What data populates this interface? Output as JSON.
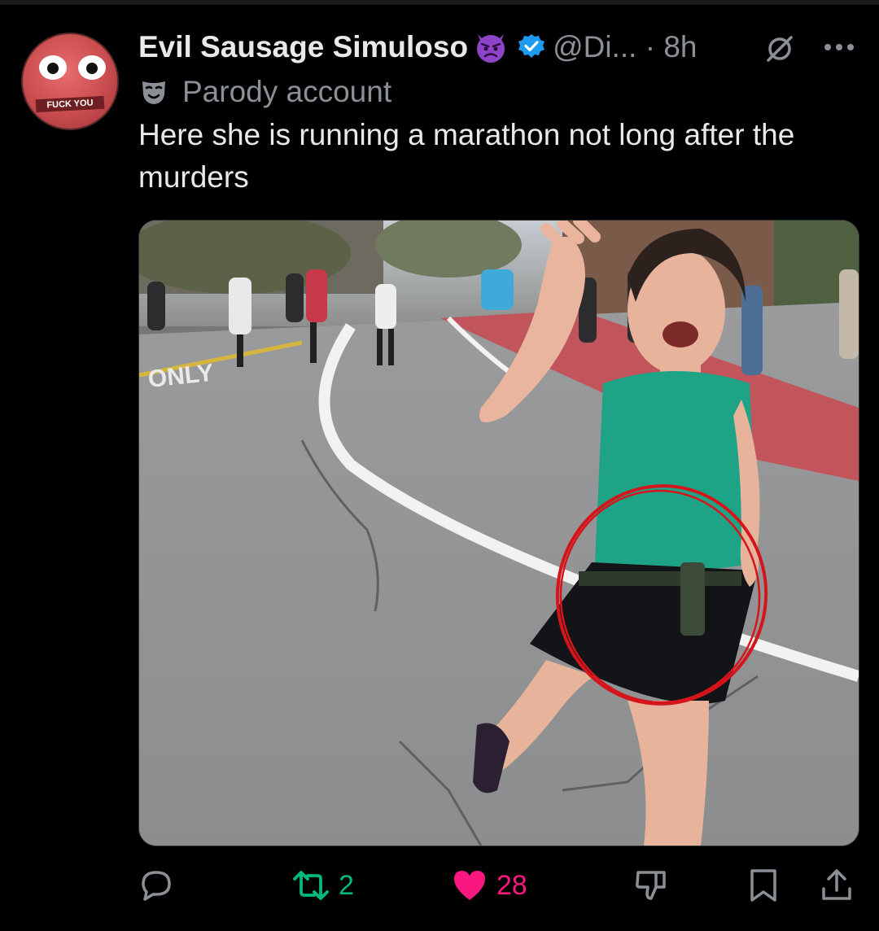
{
  "tweet": {
    "author_name": "Evil Sausage Simuloso",
    "meta": "@Di... · 8h",
    "label": "Parody account",
    "text": "Here she is running a marathon not long after the murders",
    "avatar_text": "FUCK YOU",
    "photo_road_text": "ONLY"
  },
  "actions": {
    "reply_count": "",
    "retweet_count": "2",
    "like_count": "28"
  },
  "colors": {
    "verified": "#1d9bf0",
    "retweet": "#00ba7c",
    "like": "#f91880",
    "devil": "#8e44c9",
    "muted": "#8b9096"
  },
  "icons": [
    "devil-emoji-icon",
    "verified-badge-icon",
    "grok-icon",
    "more-icon",
    "parody-mask-icon",
    "reply-icon",
    "retweet-icon",
    "like-icon",
    "dislike-icon",
    "bookmark-icon",
    "share-icon"
  ]
}
